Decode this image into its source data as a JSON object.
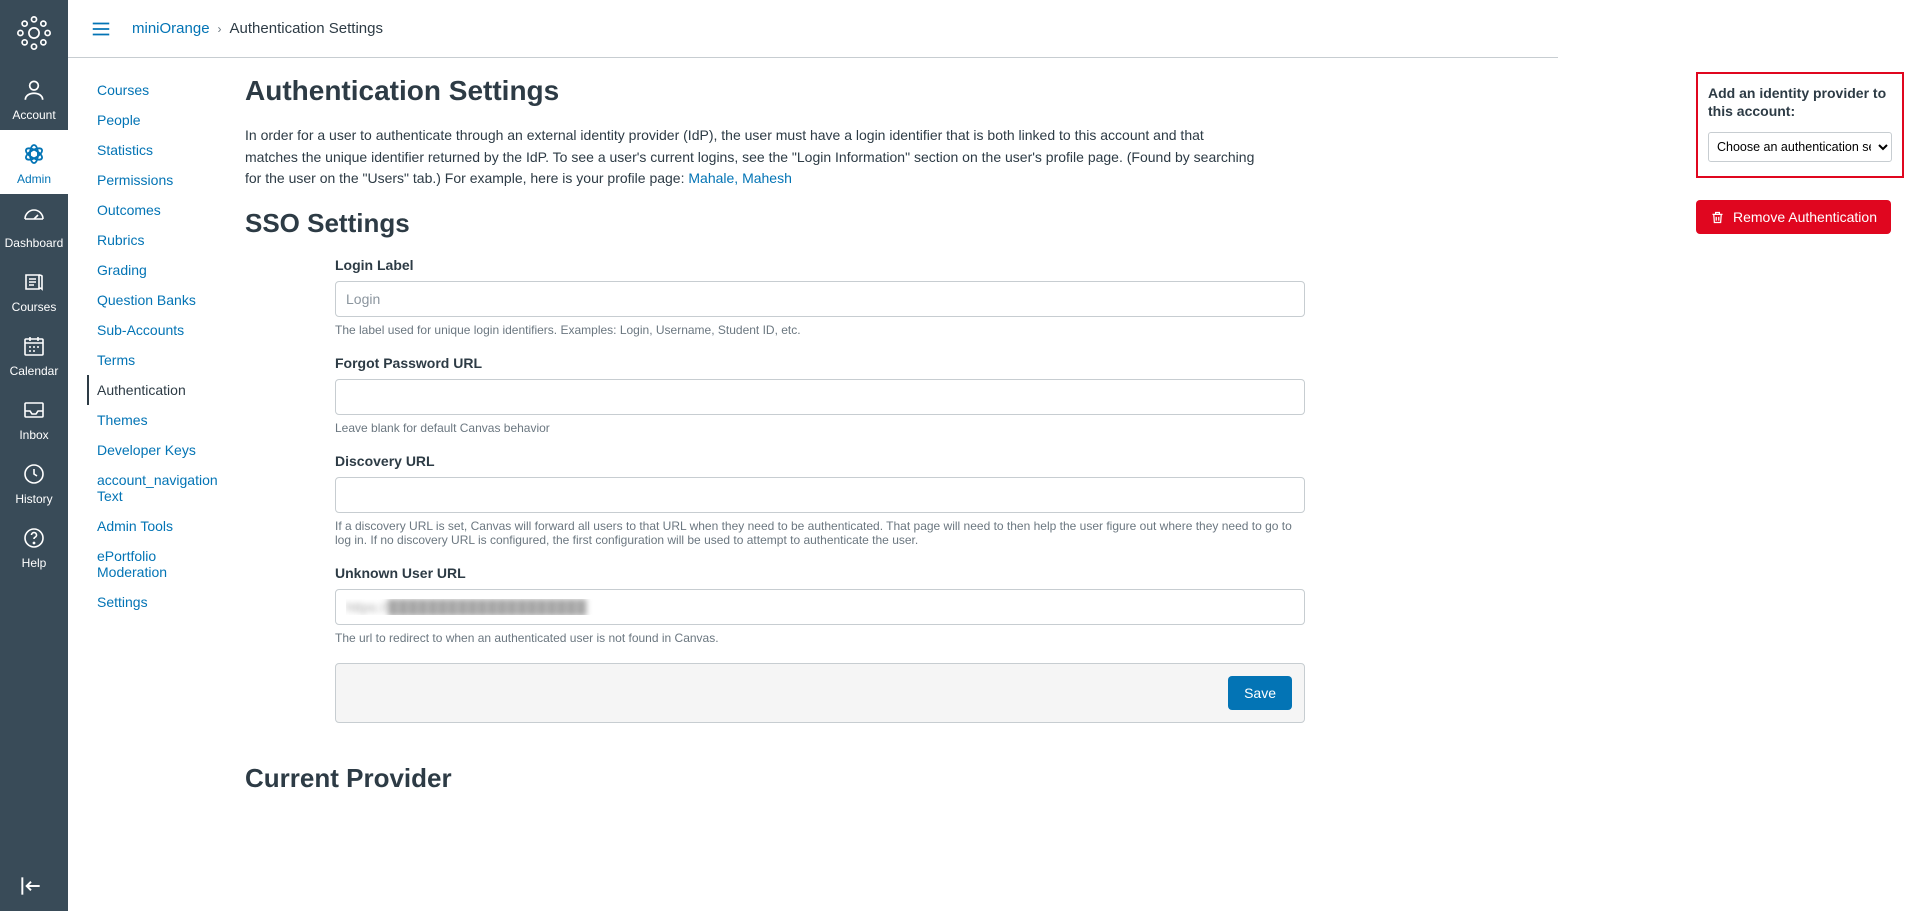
{
  "global_nav": {
    "items": [
      {
        "key": "account",
        "label": "Account"
      },
      {
        "key": "admin",
        "label": "Admin"
      },
      {
        "key": "dashboard",
        "label": "Dashboard"
      },
      {
        "key": "courses",
        "label": "Courses"
      },
      {
        "key": "calendar",
        "label": "Calendar"
      },
      {
        "key": "inbox",
        "label": "Inbox"
      },
      {
        "key": "history",
        "label": "History"
      },
      {
        "key": "help",
        "label": "Help"
      }
    ]
  },
  "breadcrumb": {
    "root": "miniOrange",
    "current": "Authentication Settings"
  },
  "secondary_nav": {
    "items": [
      "Courses",
      "People",
      "Statistics",
      "Permissions",
      "Outcomes",
      "Rubrics",
      "Grading",
      "Question Banks",
      "Sub-Accounts",
      "Terms",
      "Authentication",
      "Themes",
      "Developer Keys",
      "account_navigation Text",
      "Admin Tools",
      "ePortfolio Moderation",
      "Settings"
    ],
    "active_index": 10
  },
  "page": {
    "title": "Authentication Settings",
    "intro_1": "In order for a user to authenticate through an external identity provider (IdP), the user must have a login identifier that is both linked to this account and that matches the unique identifier returned by the IdP. To see a user's current logins, see the \"Login Information\" section on the user's profile page. (Found by searching for the user on the \"Users\" tab.) For example, here is your profile page: ",
    "profile_link": "Mahale, Mahesh",
    "sso_heading": "SSO Settings",
    "current_provider_heading": "Current Provider"
  },
  "form": {
    "login_label": {
      "label": "Login Label",
      "placeholder": "Login",
      "help": "The label used for unique login identifiers. Examples: Login, Username, Student ID, etc."
    },
    "forgot_url": {
      "label": "Forgot Password URL",
      "help": "Leave blank for default Canvas behavior"
    },
    "discovery_url": {
      "label": "Discovery URL",
      "help": "If a discovery URL is set, Canvas will forward all users to that URL when they need to be authenticated. That page will need to then help the user figure out where they need to go to log in. If no discovery URL is configured, the first configuration will be used to attempt to authenticate the user."
    },
    "unknown_user_url": {
      "label": "Unknown User URL",
      "value": "https://████████████████████",
      "help": "The url to redirect to when an authenticated user is not found in Canvas."
    },
    "save_label": "Save"
  },
  "right": {
    "idp_title": "Add an identity provider to this account:",
    "idp_select_placeholder": "Choose an authentication service",
    "remove_label": "Remove Authentication"
  }
}
